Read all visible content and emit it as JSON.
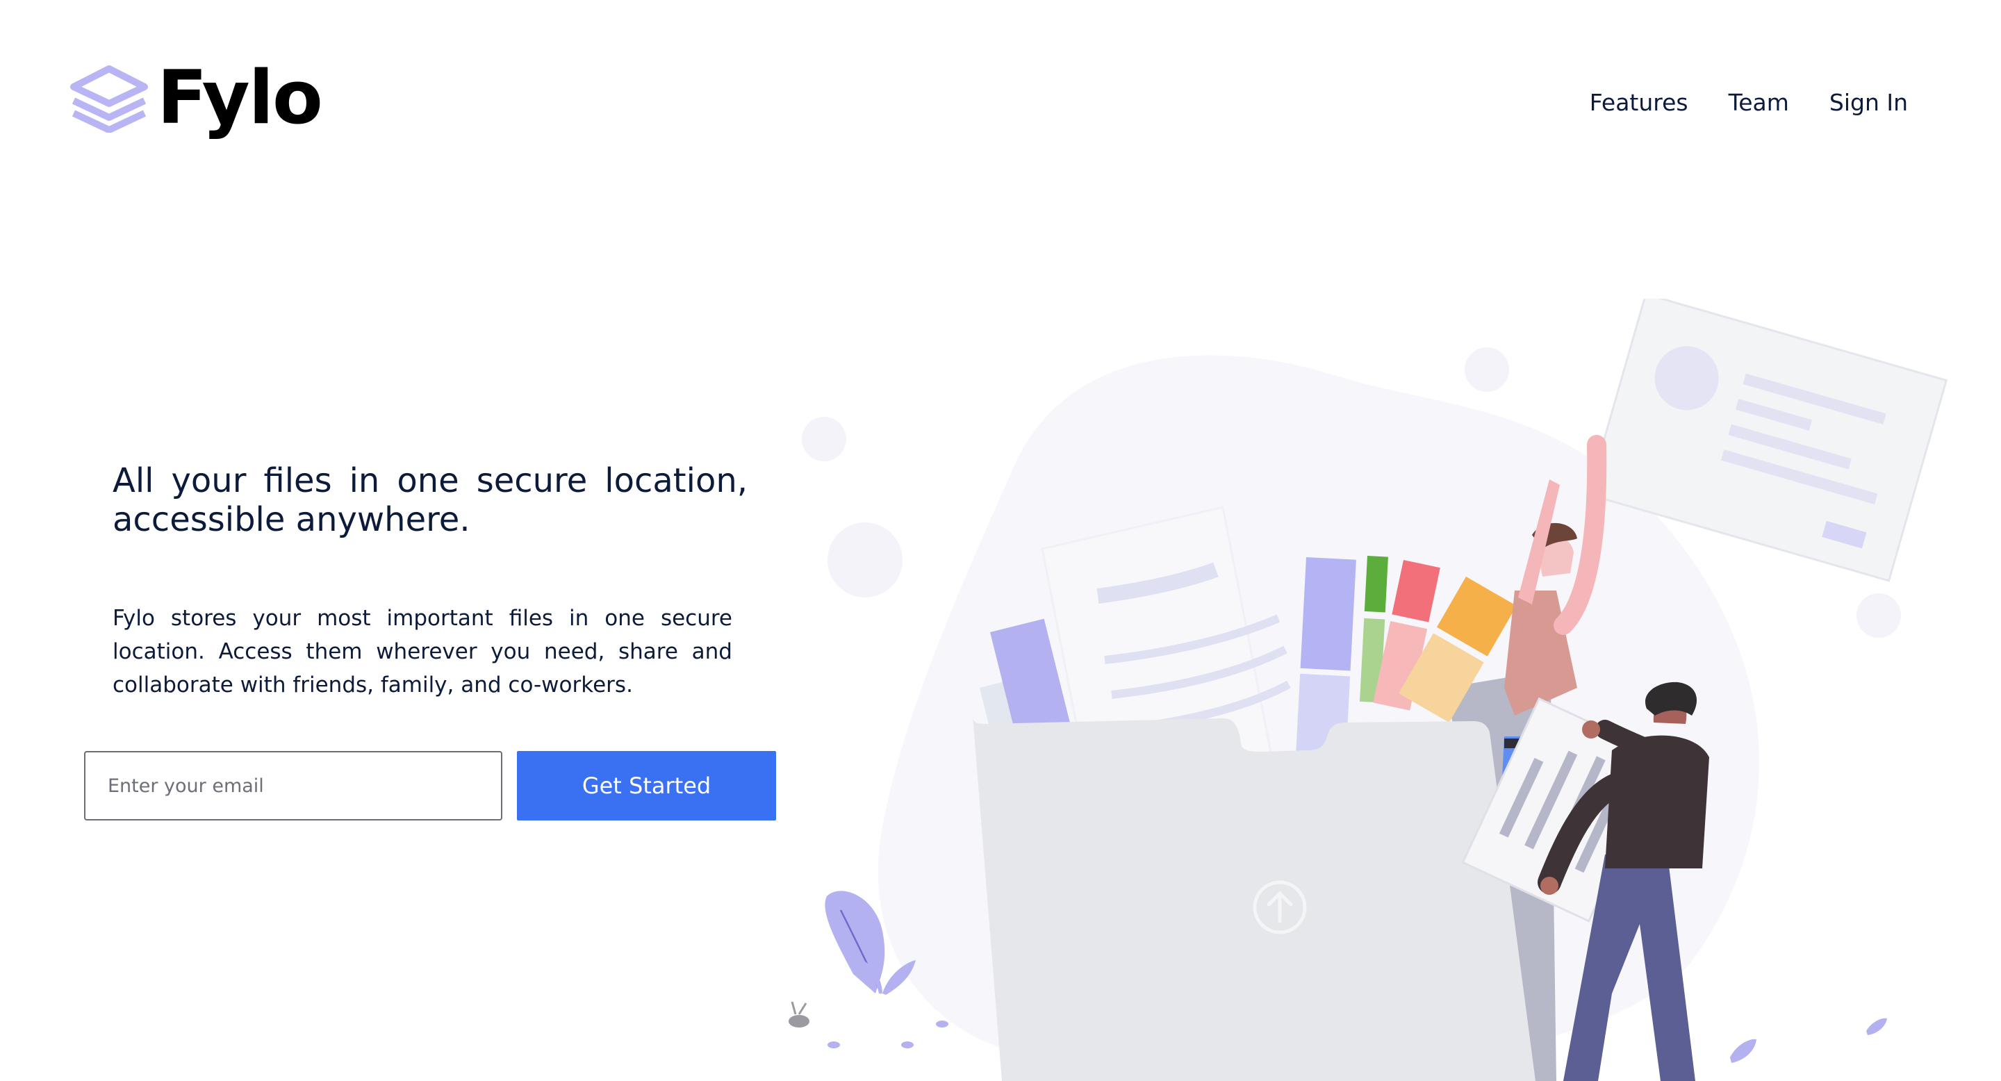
{
  "brand": {
    "name": "Fylo",
    "accent": "#3a70f2",
    "logo_color": "#b9b5f4",
    "text_color": "#0d1b3a"
  },
  "nav": {
    "items": [
      "Features",
      "Team",
      "Sign In"
    ]
  },
  "hero": {
    "headline": "All your files in one secure location, accessible anywhere.",
    "description": "Fylo stores your most important files in one secure location. Access them wherever you need, share and collaborate with friends, family, and co-workers."
  },
  "signup": {
    "email_placeholder": "Enter your email",
    "cta_label": "Get Started"
  },
  "illustration": {
    "icon": "upload-arrow-icon"
  }
}
